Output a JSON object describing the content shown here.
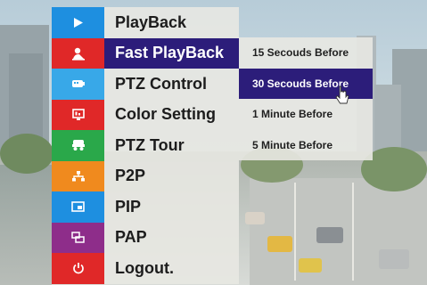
{
  "menu": {
    "items": [
      {
        "label": "PlayBack",
        "icon": "play-icon",
        "color": "#1e8fe0"
      },
      {
        "label": "Fast PlayBack",
        "icon": "fast-playback-icon",
        "color": "#e02828",
        "active": true
      },
      {
        "label": "PTZ Control",
        "icon": "ptz-control-icon",
        "color": "#38a8e8"
      },
      {
        "label": "Color Setting",
        "icon": "color-setting-icon",
        "color": "#e02828"
      },
      {
        "label": "PTZ Tour",
        "icon": "ptz-tour-icon",
        "color": "#2aa84a"
      },
      {
        "label": "P2P",
        "icon": "network-icon",
        "color": "#f08a1e"
      },
      {
        "label": "PIP",
        "icon": "pip-icon",
        "color": "#1e8fe0"
      },
      {
        "label": "PAP",
        "icon": "pap-icon",
        "color": "#8e2d8a"
      },
      {
        "label": "Logout.",
        "icon": "power-icon",
        "color": "#e02828"
      }
    ]
  },
  "submenu": {
    "items": [
      {
        "label": "15 Secouds Before"
      },
      {
        "label": "30 Secouds Before",
        "active": true
      },
      {
        "label": "1 Minute Before"
      },
      {
        "label": "5 Minute Before"
      }
    ]
  }
}
